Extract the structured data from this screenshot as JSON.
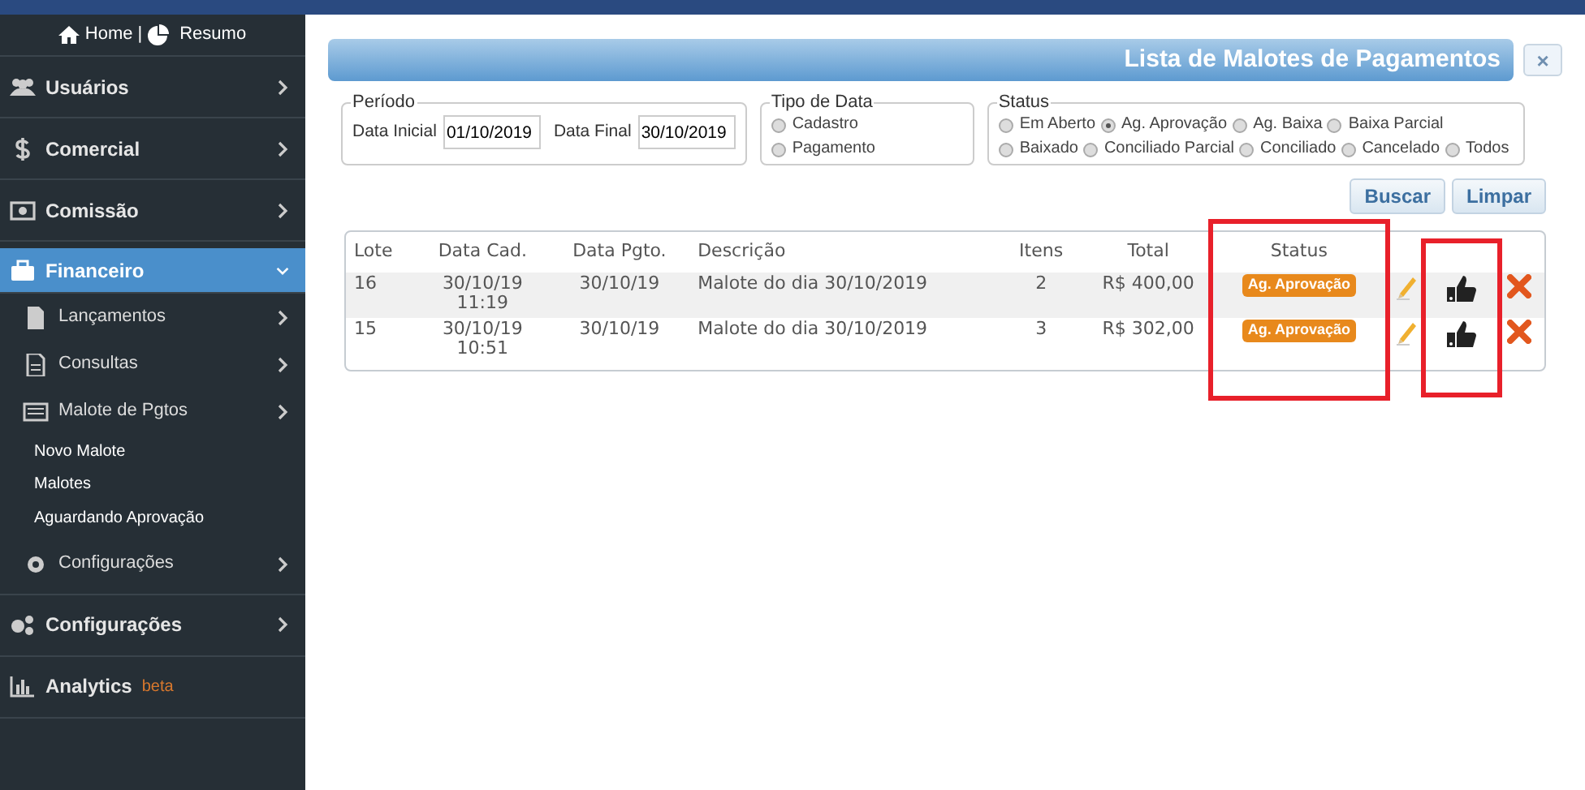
{
  "sidebar": {
    "home": "Home",
    "separator": "|",
    "resumo": "Resumo",
    "items": [
      {
        "label": "Usuários",
        "selected": false,
        "expanded": false
      },
      {
        "label": "Comercial",
        "selected": false,
        "expanded": false
      },
      {
        "label": "Comissão",
        "selected": false,
        "expanded": false
      },
      {
        "label": "Financeiro",
        "selected": true,
        "expanded": true,
        "children": [
          {
            "label": "Lançamentos"
          },
          {
            "label": "Consultas"
          },
          {
            "label": "Malote de Pgtos",
            "children": [
              {
                "label": "Novo Malote"
              },
              {
                "label": "Malotes"
              },
              {
                "label": "Aguardando Aprovação"
              }
            ]
          },
          {
            "label": "Configurações"
          }
        ]
      },
      {
        "label": "Configurações",
        "selected": false,
        "expanded": false
      },
      {
        "label": "Analytics",
        "badge": "beta",
        "selected": false
      }
    ]
  },
  "panel": {
    "title": "Lista de Malotes de Pagamentos",
    "close": "×"
  },
  "filters": {
    "periodo": {
      "legend": "Período",
      "start_label": "Data Inicial",
      "start_value": "01/10/2019",
      "end_label": "Data Final",
      "end_value": "30/10/2019"
    },
    "tipo_data": {
      "legend": "Tipo de Data",
      "options": [
        {
          "label": "Cadastro",
          "selected": false
        },
        {
          "label": "Pagamento",
          "selected": false
        }
      ]
    },
    "status": {
      "legend": "Status",
      "rows": [
        [
          {
            "label": "Em Aberto",
            "selected": false
          },
          {
            "label": "Ag. Aprovação",
            "selected": true
          },
          {
            "label": "Ag. Baixa",
            "selected": false
          },
          {
            "label": "Baixa Parcial",
            "selected": false
          }
        ],
        [
          {
            "label": "Baixado",
            "selected": false
          },
          {
            "label": "Conciliado Parcial",
            "selected": false
          },
          {
            "label": "Conciliado",
            "selected": false
          },
          {
            "label": "Cancelado",
            "selected": false
          },
          {
            "label": "Todos",
            "selected": false
          }
        ]
      ]
    }
  },
  "buttons": [
    "Buscar",
    "Limpar"
  ],
  "table": {
    "columns": [
      {
        "label": "Lote",
        "highlighted": false
      },
      {
        "label": "Data Cad.",
        "highlighted": false
      },
      {
        "label": "Data Pgto.",
        "highlighted": false
      },
      {
        "label": "Descrição",
        "highlighted": false
      },
      {
        "label": "Itens",
        "highlighted": false
      },
      {
        "label": "Total",
        "highlighted": false
      },
      {
        "label": "Status",
        "highlighted": true
      },
      {
        "highlighted": false
      },
      {
        "highlighted": true
      },
      {
        "highlighted": false
      }
    ],
    "rows": [
      {
        "lote": "16",
        "data_cad": "30/10/19",
        "hora_cad": "11:19",
        "data_pgto": "30/10/19",
        "descricao": "Malote do dia 30/10/2019",
        "itens": "2",
        "total": "R$ 400,00",
        "status": "Ag. Aprovação"
      },
      {
        "lote": "15",
        "data_cad": "30/10/19",
        "hora_cad": "10:51",
        "data_pgto": "30/10/19",
        "descricao": "Malote do dia 30/10/2019",
        "itens": "3",
        "total": "R$ 302,00",
        "status": "Ag. Aprovação"
      }
    ]
  }
}
